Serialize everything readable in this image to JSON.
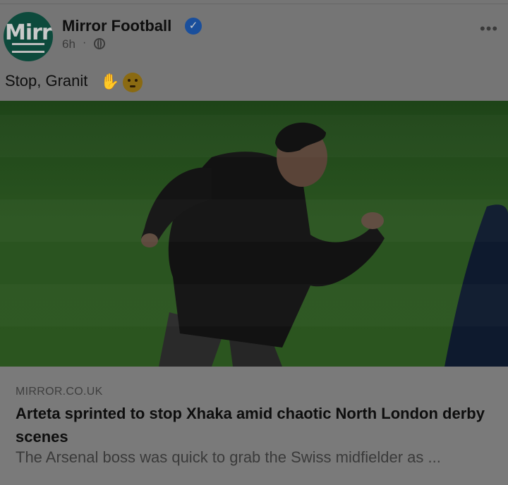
{
  "post": {
    "author": "Mirror Football",
    "verified_icon": "verified-badge-icon",
    "time": "6h",
    "separator": "·",
    "audience_icon": "globe-icon",
    "more_icon": "more-options-icon",
    "more_label": "•••",
    "avatar_text": "Mirr",
    "caption": "Stop, Granit",
    "caption_emojis": [
      "raised-hand-emoji",
      "flushed-face-emoji"
    ]
  },
  "link_preview": {
    "domain": "MIRROR.CO.UK",
    "headline": "Arteta sprinted to stop Xhaka amid chaotic North London derby scenes",
    "summary": "The Arsenal boss was quick to grab the Swiss midfielder as ..."
  },
  "colors": {
    "overlay_dim": "#757575",
    "verified_blue": "#1a4f9c",
    "pitch_green": "#2a5420",
    "avatar_green": "#0d4a3c"
  }
}
